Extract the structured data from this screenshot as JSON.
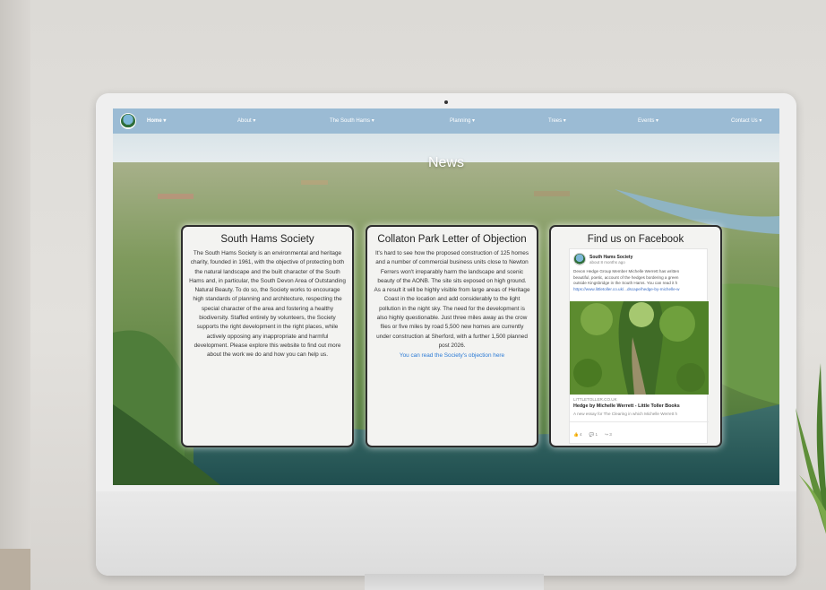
{
  "nav": {
    "items": [
      "Home ▾",
      "About ▾",
      "The South Hams ▾",
      "Planning ▾",
      "Trees ▾",
      "Events ▾",
      "Contact Us ▾"
    ]
  },
  "page": {
    "title": "News"
  },
  "cards": {
    "society": {
      "title": "South Hams Society",
      "body": "The South Hams Society is an environmental and heritage charity, founded in 1961, with the objective of protecting both the natural landscape and the built character of the South Hams and, in particular, the South Devon Area of Outstanding Natural Beauty. To do so, the Society works to encourage high standards of planning and architecture, respecting the special character of the area and fostering a healthy biodiversity. Staffed entirely by volunteers, the Society supports the right development in the right places, while actively opposing any inappropriate and harmful development. Please explore this website to find out more about the work we do and how you can help us."
    },
    "collaton": {
      "title": "Collaton Park Letter of Objection",
      "body": "It's hard to see how the proposed construction of 125 homes and a number of commercial business units close to Newton Ferrers won't irreparably harm the landscape and scenic beauty of the AONB. The site sits exposed on high ground. As a result it will be highly visible from large areas of Heritage Coast in the location and add considerably to the light pollution in the night sky. The need for the development is also highly questionable. Just three miles away as the crow flies or five miles by road 5,500 new homes are currently under construction at Sherford, with a further 1,500 planned post 2026.",
      "link": "You can read the Society's objection here"
    },
    "facebook": {
      "title": "Find us on Facebook",
      "page_name": "South Hams Society",
      "time": "about 8 months ago",
      "text_lines": [
        "Devon Hedge Group Member Michelle Werrett has written",
        "beautiful, poetic, account of the hedges bordering a green",
        "outside Kingsbridge in the South Hams. You can read it h",
        "https://www.littletoller.co.uk/...dscape/hedge-by-michelle-w"
      ],
      "domain": "LITTLETOLLER.CO.UK",
      "link_title": "Hedge by Michelle Werrett - Little Toller Books",
      "link_desc": "A new essay for The Clearing in which Michelle Werrett h",
      "stats": [
        "👍 4",
        "💬 1",
        "↪ 3"
      ]
    }
  },
  "colors": {
    "nav_bg": "#9bbbd4",
    "link": "#2c7bd6",
    "card_border": "#2d2d2d"
  }
}
